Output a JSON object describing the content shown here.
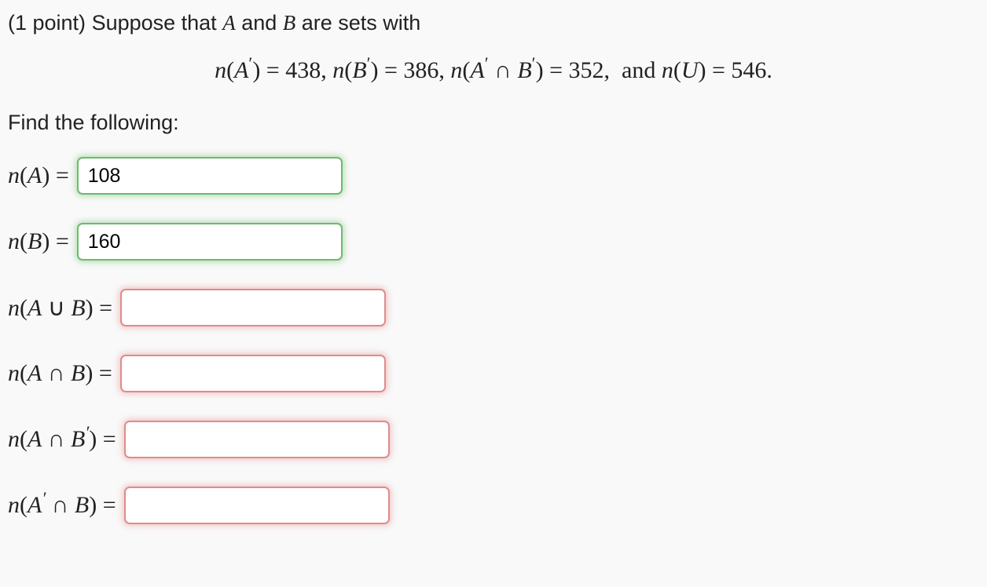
{
  "header": {
    "points_prefix": "(1 point) ",
    "text_before_A": "Suppose that ",
    "A": "A",
    "text_mid": " and ",
    "B": "B",
    "text_after": " are sets with"
  },
  "given": {
    "nAprime": "438",
    "nBprime": "386",
    "nAprime_int_Bprime": "352",
    "nU": "546",
    "and_text": "and"
  },
  "instruction": "Find the following:",
  "questions": [
    {
      "label_html": "n(A) =",
      "value": "108",
      "status": "correct"
    },
    {
      "label_html": "n(B) =",
      "value": "160",
      "status": "correct"
    },
    {
      "label_html": "n(A ∪ B) =",
      "value": "",
      "status": "incorrect"
    },
    {
      "label_html": "n(A ∩ B) =",
      "value": "",
      "status": "incorrect"
    },
    {
      "label_html": "n(A ∩ B′) =",
      "value": "",
      "status": "incorrect"
    },
    {
      "label_html": "n(A′ ∩ B) =",
      "value": "",
      "status": "incorrect"
    }
  ]
}
